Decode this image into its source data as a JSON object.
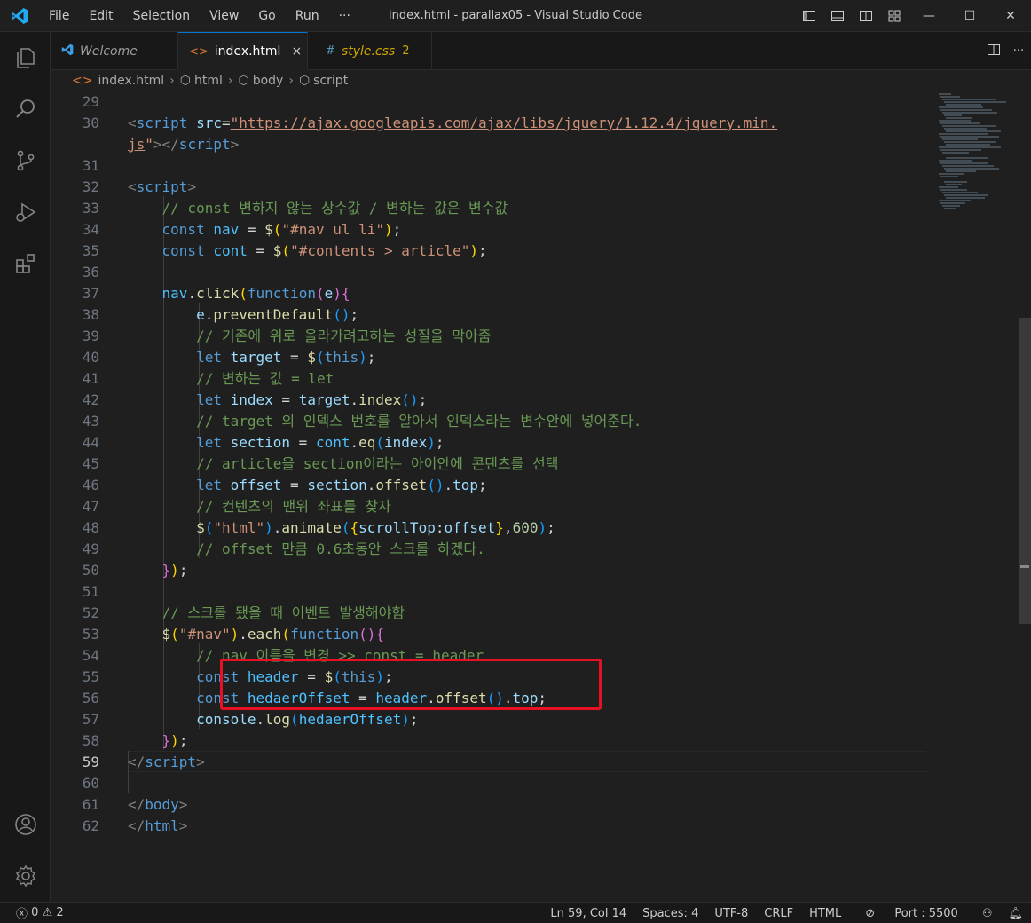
{
  "menu": [
    "File",
    "Edit",
    "Selection",
    "View",
    "Go",
    "Run",
    "···"
  ],
  "window_title": "index.html - parallax05 - Visual Studio Code",
  "window_controls": {
    "minimize": "—",
    "maximize": "☐",
    "close": "✕"
  },
  "tabs": [
    {
      "label": "Welcome",
      "icon": "vscode-icon"
    },
    {
      "label": "index.html",
      "icon": "html-file-icon",
      "close": "×"
    },
    {
      "label": "style.css",
      "icon": "css-file-icon",
      "badge": "2"
    }
  ],
  "breadcrumb": [
    "index.html",
    "html",
    "body",
    "script"
  ],
  "status": {
    "errors": "0",
    "warnings": "2",
    "position": "Ln 59, Col 14",
    "spaces": "Spaces: 4",
    "encoding": "UTF-8",
    "eol": "CRLF",
    "language": "HTML",
    "port": "Port : 5500"
  },
  "current_line": "59",
  "code_lines": [
    {
      "n": "29",
      "html": ""
    },
    {
      "n": "30",
      "html": "<span class='tg'>&lt;</span><span class='tn'>script</span> <span class='at'>src</span>=<span class='stu'>\"https://ajax.googleapis.com/ajax/libs/jquery/1.12.4/jquery.min.</span>"
    },
    {
      "n": "",
      "html": "<span class='stu'>js</span><span class='st'>\"</span><span class='tg'>&gt;&lt;/</span><span class='tn'>script</span><span class='tg'>&gt;</span>"
    },
    {
      "n": "31",
      "html": ""
    },
    {
      "n": "32",
      "html": "<span class='tg'>&lt;</span><span class='tn'>script</span><span class='tg'>&gt;</span>"
    },
    {
      "n": "33",
      "html": "    <span class='cm'>// const 변하지 않는 상수값 / 변하는 값은 변수값</span>"
    },
    {
      "n": "34",
      "html": "    <span class='k'>const</span> <span class='cn'>nav</span> = <span class='fn'>$</span><span class='p1'>(</span><span class='st'>\"#nav ul li\"</span><span class='p1'>)</span>;"
    },
    {
      "n": "35",
      "html": "    <span class='k'>const</span> <span class='cn'>cont</span> = <span class='fn'>$</span><span class='p1'>(</span><span class='st'>\"#contents &gt; article\"</span><span class='p1'>)</span>;"
    },
    {
      "n": "36",
      "html": ""
    },
    {
      "n": "37",
      "html": "    <span class='cn'>nav</span>.<span class='fn'>click</span><span class='p1'>(</span><span class='k'>function</span><span class='p2'>(</span><span class='v'>e</span><span class='p2'>){</span>"
    },
    {
      "n": "38",
      "html": "        <span class='v'>e</span>.<span class='fn'>preventDefault</span><span class='p3'>()</span>;"
    },
    {
      "n": "39",
      "html": "        <span class='cm'>// 기존에 위로 올라가려고하는 성질을 막아줌</span>"
    },
    {
      "n": "40",
      "html": "        <span class='k'>let</span> <span class='v'>target</span> = <span class='fn'>$</span><span class='p3'>(</span><span class='k'>this</span><span class='p3'>)</span>;"
    },
    {
      "n": "41",
      "html": "        <span class='cm'>// 변하는 값 = let</span>"
    },
    {
      "n": "42",
      "html": "        <span class='k'>let</span> <span class='v'>index</span> = <span class='v'>target</span>.<span class='fn'>index</span><span class='p3'>()</span>;"
    },
    {
      "n": "43",
      "html": "        <span class='cm'>// target 의 인덱스 번호를 알아서 인덱스라는 변수안에 넣어준다.</span>"
    },
    {
      "n": "44",
      "html": "        <span class='k'>let</span> <span class='v'>section</span> = <span class='cn'>cont</span>.<span class='fn'>eq</span><span class='p3'>(</span><span class='v'>index</span><span class='p3'>)</span>;"
    },
    {
      "n": "45",
      "html": "        <span class='cm'>// article을 section이라는 아이안에 콘텐츠를 선택</span>"
    },
    {
      "n": "46",
      "html": "        <span class='k'>let</span> <span class='v'>offset</span> = <span class='v'>section</span>.<span class='fn'>offset</span><span class='p3'>()</span>.<span class='v'>top</span>;"
    },
    {
      "n": "47",
      "html": "        <span class='cm'>// 컨텐츠의 맨위 좌표를 찾자</span>"
    },
    {
      "n": "48",
      "html": "        <span class='fn'>$</span><span class='p3'>(</span><span class='st'>\"html\"</span><span class='p3'>)</span>.<span class='fn'>animate</span><span class='p3'>(</span><span class='p1'>{</span><span class='v'>scrollTop</span>:<span class='v'>offset</span><span class='p1'>}</span>,<span class='nm'>600</span><span class='p3'>)</span>;"
    },
    {
      "n": "49",
      "html": "        <span class='cm'>// offset 만큼 0.6초동안 스크롤 하겠다.</span>"
    },
    {
      "n": "50",
      "html": "    <span class='p2'>}</span><span class='p1'>)</span>;"
    },
    {
      "n": "51",
      "html": ""
    },
    {
      "n": "52",
      "html": "    <span class='cm'>// 스크롤 됐을 때 이벤트 발생해야함</span>"
    },
    {
      "n": "53",
      "html": "    <span class='fn'>$</span><span class='p1'>(</span><span class='st'>\"#nav\"</span><span class='p1'>)</span>.<span class='fn'>each</span><span class='p1'>(</span><span class='k'>function</span><span class='p2'>(){</span>"
    },
    {
      "n": "54",
      "html": "        <span class='cm'>// nav 이름을 변경 &gt;&gt; const = header</span>"
    },
    {
      "n": "55",
      "html": "        <span class='k'>const</span> <span class='cn'>header</span> = <span class='fn'>$</span><span class='p3'>(</span><span class='k'>this</span><span class='p3'>)</span>;"
    },
    {
      "n": "56",
      "html": "        <span class='k'>const</span> <span class='cn'>hedaerOffset</span> = <span class='cn'>header</span>.<span class='fn'>offset</span><span class='p3'>()</span>.<span class='v'>top</span>;"
    },
    {
      "n": "57",
      "html": "        <span class='v'>console</span>.<span class='fn'>log</span><span class='p3'>(</span><span class='cn'>hedaerOffset</span><span class='p3'>)</span>;"
    },
    {
      "n": "58",
      "html": "    <span class='p2'>}</span><span class='p1'>)</span>;"
    },
    {
      "n": "59",
      "html": "<span class='tg'>&lt;/</span><span class='tn'>script</span><span class='tg'>&gt;</span>"
    },
    {
      "n": "60",
      "html": ""
    },
    {
      "n": "61",
      "html": "<span class='tg'>&lt;/</span><span class='tn'>body</span><span class='tg'>&gt;</span>"
    },
    {
      "n": "62",
      "html": "<span class='tg'>&lt;/</span><span class='tn'>html</span><span class='tg'>&gt;</span>"
    }
  ],
  "colors": {
    "editor_bg": "#1f1f1f",
    "accent": "#0078d4",
    "highlight_box": "#e81123",
    "html_icon": "#e37933",
    "css_icon": "#519aba",
    "warning_badge": "#cca700"
  }
}
